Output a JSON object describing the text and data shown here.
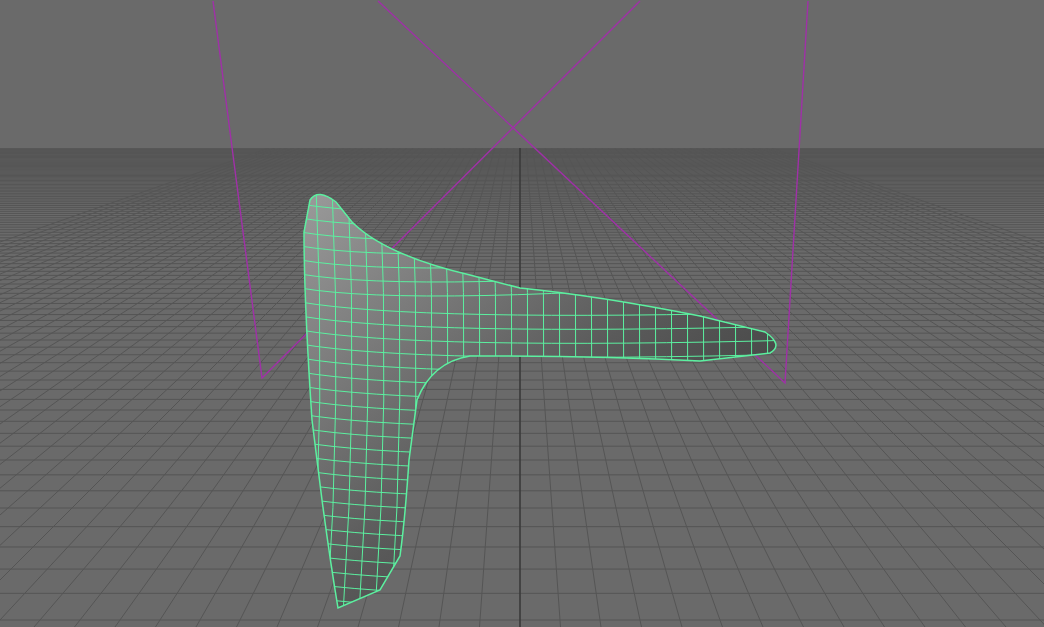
{
  "viewport": {
    "grid": {
      "visible": true
    },
    "mesh": {
      "selected": true
    }
  }
}
